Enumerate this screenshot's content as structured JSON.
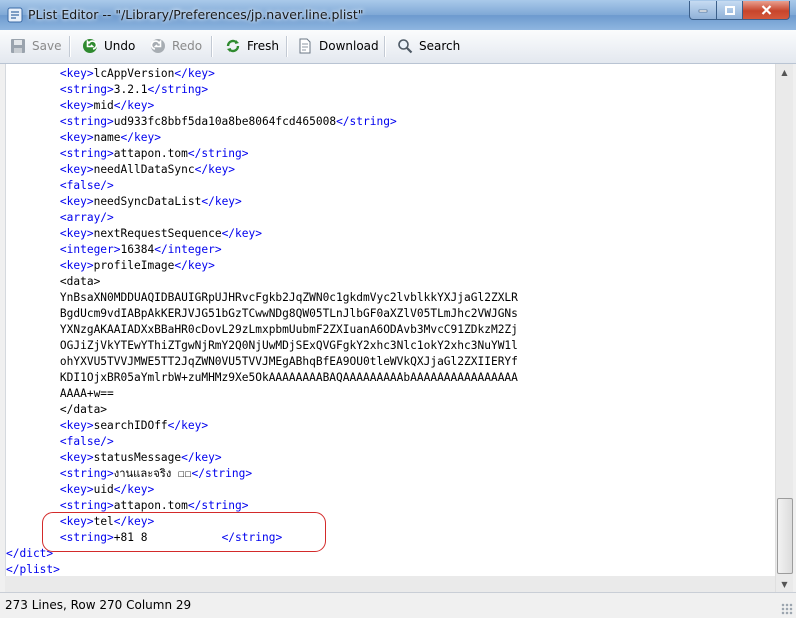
{
  "window": {
    "title": "PList Editor  --  \"/Library/Preferences/jp.naver.line.plist\""
  },
  "toolbar": {
    "save": "Save",
    "undo": "Undo",
    "redo": "Redo",
    "fresh": "Fresh",
    "download": "Download",
    "search": "Search"
  },
  "editor": {
    "lines": [
      {
        "i": "        ",
        "o": "<key>",
        "t": "lcAppVersion",
        "c": "</key>"
      },
      {
        "i": "        ",
        "o": "<string>",
        "t": "3.2.1",
        "c": "</string>"
      },
      {
        "i": "        ",
        "o": "<key>",
        "t": "mid",
        "c": "</key>"
      },
      {
        "i": "        ",
        "o": "<string>",
        "t": "ud933fc8bbf5da10a8be8064fcd465008",
        "c": "</string>"
      },
      {
        "i": "        ",
        "o": "<key>",
        "t": "name",
        "c": "</key>"
      },
      {
        "i": "        ",
        "o": "<string>",
        "t": "attapon.tom",
        "c": "</string>"
      },
      {
        "i": "        ",
        "o": "<key>",
        "t": "needAllDataSync",
        "c": "</key>"
      },
      {
        "i": "        ",
        "o": "<false/>",
        "t": "",
        "c": ""
      },
      {
        "i": "        ",
        "o": "<key>",
        "t": "needSyncDataList",
        "c": "</key>"
      },
      {
        "i": "        ",
        "o": "<array/>",
        "t": "",
        "c": ""
      },
      {
        "i": "        ",
        "o": "<key>",
        "t": "nextRequestSequence",
        "c": "</key>"
      },
      {
        "i": "        ",
        "o": "<integer>",
        "t": "16384",
        "c": "</integer>"
      },
      {
        "i": "        ",
        "o": "<key>",
        "t": "profileImage",
        "c": "</key>"
      },
      {
        "i": "        ",
        "o": "",
        "t": "<data>",
        "c": ""
      },
      {
        "i": "        ",
        "o": "",
        "t": "YnBsaXN0MDDUAQIDBAUIGRpUJHRvcFgkb2JqZWN0c1gkdmVyc2lvblkkYXJjaGl2ZXLR",
        "c": ""
      },
      {
        "i": "        ",
        "o": "",
        "t": "BgdUcm9vdIABpAkKERJVJG51bGzTCwwNDg8QW05TLnJlbGF0aXZlV05TLmJhc2VWJGNs",
        "c": ""
      },
      {
        "i": "        ",
        "o": "",
        "t": "YXNzgAKAAIADXxBBaHR0cDovL29zLmxpbmUubmF2ZXIuanA6ODAvb3MvcC91ZDkzM2Zj",
        "c": ""
      },
      {
        "i": "        ",
        "o": "",
        "t": "OGJiZjVkYTEwYThiZTgwNjRmY2Q0NjUwMDjSExQVGFgkY2xhc3Nlc1okY2xhc3NuYW1l",
        "c": ""
      },
      {
        "i": "        ",
        "o": "",
        "t": "ohYXVU5TVVJMWE5TT2JqZWN0VU5TVVJMEgABhqBfEA9OU0tleWVkQXJjaGl2ZXIIERYf",
        "c": ""
      },
      {
        "i": "        ",
        "o": "",
        "t": "KDI1OjxBR05aYmlrbW+zuMHMz9Xe5OkAAAAAAAABAQAAAAAAAAAbAAAAAAAAAAAAAAAA",
        "c": ""
      },
      {
        "i": "        ",
        "o": "",
        "t": "AAAA+w==",
        "c": ""
      },
      {
        "i": "        ",
        "o": "",
        "t": "</data>",
        "c": ""
      },
      {
        "i": "        ",
        "o": "<key>",
        "t": "searchIDOff",
        "c": "</key>"
      },
      {
        "i": "        ",
        "o": "<false/>",
        "t": "",
        "c": ""
      },
      {
        "i": "        ",
        "o": "<key>",
        "t": "statusMessage",
        "c": "</key>"
      },
      {
        "i": "        ",
        "o": "<string>",
        "t": "งานและจริง ☐☐",
        "c": "</string>"
      },
      {
        "i": "        ",
        "o": "<key>",
        "t": "uid",
        "c": "</key>"
      },
      {
        "i": "        ",
        "o": "<string>",
        "t": "attapon.tom",
        "c": "</string>"
      },
      {
        "i": "        ",
        "o": "<key>",
        "t": "tel",
        "c": "</key>"
      },
      {
        "i": "        ",
        "o": "<string>",
        "t": "+81 8           ",
        "c": "</string>"
      },
      {
        "i": "",
        "o": "</dict>",
        "t": "",
        "c": ""
      },
      {
        "i": "",
        "o": "</plist>",
        "t": "",
        "c": ""
      }
    ]
  },
  "status": {
    "text": "273 Lines, Row 270 Column 29"
  }
}
